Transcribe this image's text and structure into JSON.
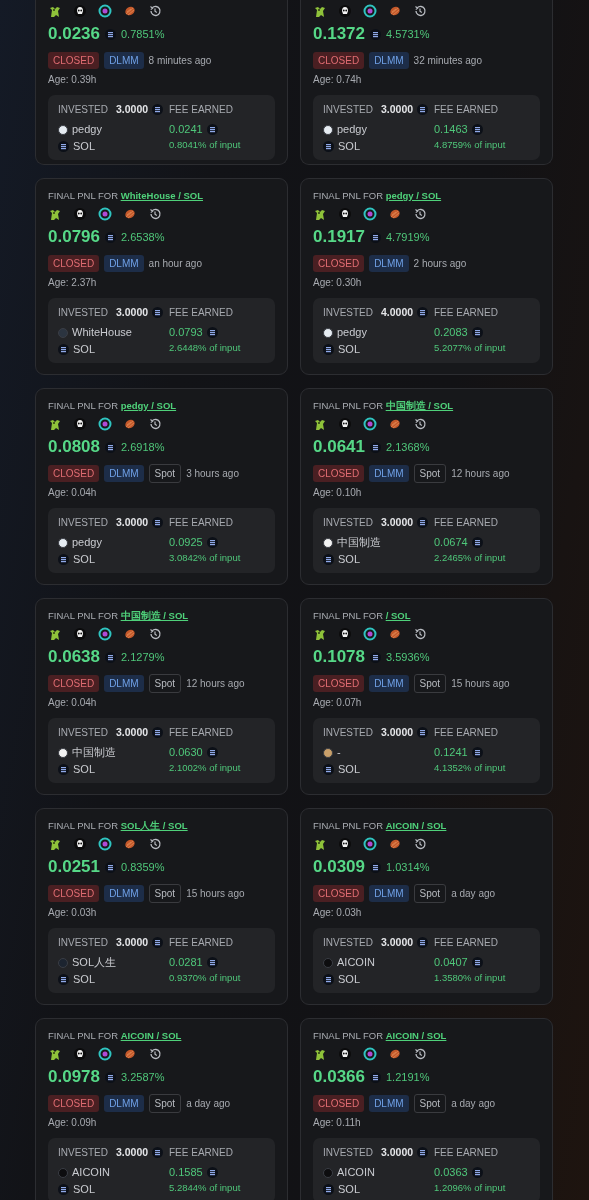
{
  "cards": [
    {
      "pnl": "0.0236",
      "pnl_pct": "0.7851%",
      "badges": [
        {
          "kind": "closed",
          "text": "CLOSED"
        },
        {
          "kind": "dlmm",
          "text": "DLMM"
        }
      ],
      "time": "8 minutes ago",
      "age": "Age: 0.39h",
      "invested_label": "INVESTED",
      "invested": "3.0000",
      "token": {
        "name": "pedgy",
        "color": "#e6ecf2"
      },
      "quote": "SOL",
      "fee_label": "FEE EARNED",
      "fee": "0.0241",
      "fee_pct": "0.8041% of input"
    },
    {
      "pnl": "0.1372",
      "pnl_pct": "4.5731%",
      "badges": [
        {
          "kind": "closed",
          "text": "CLOSED"
        },
        {
          "kind": "dlmm",
          "text": "DLMM"
        }
      ],
      "time": "32 minutes ago",
      "age": "Age: 0.74h",
      "invested_label": "INVESTED",
      "invested": "3.0000",
      "token": {
        "name": "pedgy",
        "color": "#e6ecf2"
      },
      "quote": "SOL",
      "fee_label": "FEE EARNED",
      "fee": "0.1463",
      "fee_pct": "4.8759% of input"
    },
    {
      "title": "FINAL PNL FOR",
      "pair": "WhiteHouse / SOL",
      "pnl": "0.0796",
      "pnl_pct": "2.6538%",
      "badges": [
        {
          "kind": "closed",
          "text": "CLOSED"
        },
        {
          "kind": "dlmm",
          "text": "DLMM"
        }
      ],
      "time": "an hour ago",
      "age": "Age: 2.37h",
      "invested_label": "INVESTED",
      "invested": "3.0000",
      "token": {
        "name": "WhiteHouse",
        "color": "#2b3440"
      },
      "quote": "SOL",
      "fee_label": "FEE EARNED",
      "fee": "0.0793",
      "fee_pct": "2.6448% of input"
    },
    {
      "title": "FINAL PNL FOR",
      "pair": "pedgy / SOL",
      "pnl": "0.1917",
      "pnl_pct": "4.7919%",
      "badges": [
        {
          "kind": "closed",
          "text": "CLOSED"
        },
        {
          "kind": "dlmm",
          "text": "DLMM"
        }
      ],
      "time": "2 hours ago",
      "age": "Age: 0.30h",
      "invested_label": "INVESTED",
      "invested": "4.0000",
      "token": {
        "name": "pedgy",
        "color": "#e6ecf2"
      },
      "quote": "SOL",
      "fee_label": "FEE EARNED",
      "fee": "0.2083",
      "fee_pct": "5.2077% of input"
    },
    {
      "title": "FINAL PNL FOR",
      "pair": "pedgy / SOL",
      "pnl": "0.0808",
      "pnl_pct": "2.6918%",
      "badges": [
        {
          "kind": "closed",
          "text": "CLOSED"
        },
        {
          "kind": "dlmm",
          "text": "DLMM"
        },
        {
          "kind": "spot",
          "text": "Spot"
        }
      ],
      "time": "3 hours ago",
      "age": "Age: 0.04h",
      "invested_label": "INVESTED",
      "invested": "3.0000",
      "token": {
        "name": "pedgy",
        "color": "#e6ecf2"
      },
      "quote": "SOL",
      "fee_label": "FEE EARNED",
      "fee": "0.0925",
      "fee_pct": "3.0842% of input"
    },
    {
      "title": "FINAL PNL FOR",
      "pair": "中国制造 / SOL",
      "pnl": "0.0641",
      "pnl_pct": "2.1368%",
      "badges": [
        {
          "kind": "closed",
          "text": "CLOSED"
        },
        {
          "kind": "dlmm",
          "text": "DLMM"
        },
        {
          "kind": "spot",
          "text": "Spot"
        }
      ],
      "time": "12 hours ago",
      "age": "Age: 0.10h",
      "invested_label": "INVESTED",
      "invested": "3.0000",
      "token": {
        "name": "中国制造",
        "color": "#f2f2f2"
      },
      "quote": "SOL",
      "fee_label": "FEE EARNED",
      "fee": "0.0674",
      "fee_pct": "2.2465% of input"
    },
    {
      "title": "FINAL PNL FOR",
      "pair": "中国制造 / SOL",
      "pnl": "0.0638",
      "pnl_pct": "2.1279%",
      "badges": [
        {
          "kind": "closed",
          "text": "CLOSED"
        },
        {
          "kind": "dlmm",
          "text": "DLMM"
        },
        {
          "kind": "spot",
          "text": "Spot"
        }
      ],
      "time": "12 hours ago",
      "age": "Age: 0.04h",
      "invested_label": "INVESTED",
      "invested": "3.0000",
      "token": {
        "name": "中国制造",
        "color": "#f2f2f2"
      },
      "quote": "SOL",
      "fee_label": "FEE EARNED",
      "fee": "0.0630",
      "fee_pct": "2.1002% of input"
    },
    {
      "title": "FINAL PNL FOR",
      "pair": "/ SOL",
      "pnl": "0.1078",
      "pnl_pct": "3.5936%",
      "badges": [
        {
          "kind": "closed",
          "text": "CLOSED"
        },
        {
          "kind": "dlmm",
          "text": "DLMM"
        },
        {
          "kind": "spot",
          "text": "Spot"
        }
      ],
      "time": "15 hours ago",
      "age": "Age: 0.07h",
      "invested_label": "INVESTED",
      "invested": "3.0000",
      "token": {
        "name": "-",
        "color": "#c9a06a"
      },
      "quote": "SOL",
      "fee_label": "FEE EARNED",
      "fee": "0.1241",
      "fee_pct": "4.1352% of input"
    },
    {
      "title": "FINAL PNL FOR",
      "pair": "SOL人生 / SOL",
      "pnl": "0.0251",
      "pnl_pct": "0.8359%",
      "badges": [
        {
          "kind": "closed",
          "text": "CLOSED"
        },
        {
          "kind": "dlmm",
          "text": "DLMM"
        },
        {
          "kind": "spot",
          "text": "Spot"
        }
      ],
      "time": "15 hours ago",
      "age": "Age: 0.03h",
      "invested_label": "INVESTED",
      "invested": "3.0000",
      "token": {
        "name": "SOL人生",
        "color": "#1c2430"
      },
      "quote": "SOL",
      "fee_label": "FEE EARNED",
      "fee": "0.0281",
      "fee_pct": "0.9370% of input"
    },
    {
      "title": "FINAL PNL FOR",
      "pair": "AICOIN / SOL",
      "pnl": "0.0309",
      "pnl_pct": "1.0314%",
      "badges": [
        {
          "kind": "closed",
          "text": "CLOSED"
        },
        {
          "kind": "dlmm",
          "text": "DLMM"
        },
        {
          "kind": "spot",
          "text": "Spot"
        }
      ],
      "time": "a day ago",
      "age": "Age: 0.03h",
      "invested_label": "INVESTED",
      "invested": "3.0000",
      "token": {
        "name": "AICOIN",
        "color": "#0d0d0f"
      },
      "quote": "SOL",
      "fee_label": "FEE EARNED",
      "fee": "0.0407",
      "fee_pct": "1.3580% of input"
    },
    {
      "title": "FINAL PNL FOR",
      "pair": "AICOIN / SOL",
      "pnl": "0.0978",
      "pnl_pct": "3.2587%",
      "badges": [
        {
          "kind": "closed",
          "text": "CLOSED"
        },
        {
          "kind": "dlmm",
          "text": "DLMM"
        },
        {
          "kind": "spot",
          "text": "Spot"
        }
      ],
      "time": "a day ago",
      "age": "Age: 0.09h",
      "invested_label": "INVESTED",
      "invested": "3.0000",
      "token": {
        "name": "AICOIN",
        "color": "#0d0d0f"
      },
      "quote": "SOL",
      "fee_label": "FEE EARNED",
      "fee": "0.1585",
      "fee_pct": "5.2844% of input"
    },
    {
      "title": "FINAL PNL FOR",
      "pair": "AICOIN / SOL",
      "pnl": "0.0366",
      "pnl_pct": "1.2191%",
      "badges": [
        {
          "kind": "closed",
          "text": "CLOSED"
        },
        {
          "kind": "dlmm",
          "text": "DLMM"
        },
        {
          "kind": "spot",
          "text": "Spot"
        }
      ],
      "time": "a day ago",
      "age": "Age: 0.11h",
      "invested_label": "INVESTED",
      "invested": "3.0000",
      "token": {
        "name": "AICOIN",
        "color": "#0d0d0f"
      },
      "quote": "SOL",
      "fee_label": "FEE EARNED",
      "fee": "0.0363",
      "fee_pct": "1.2096% of input"
    }
  ]
}
